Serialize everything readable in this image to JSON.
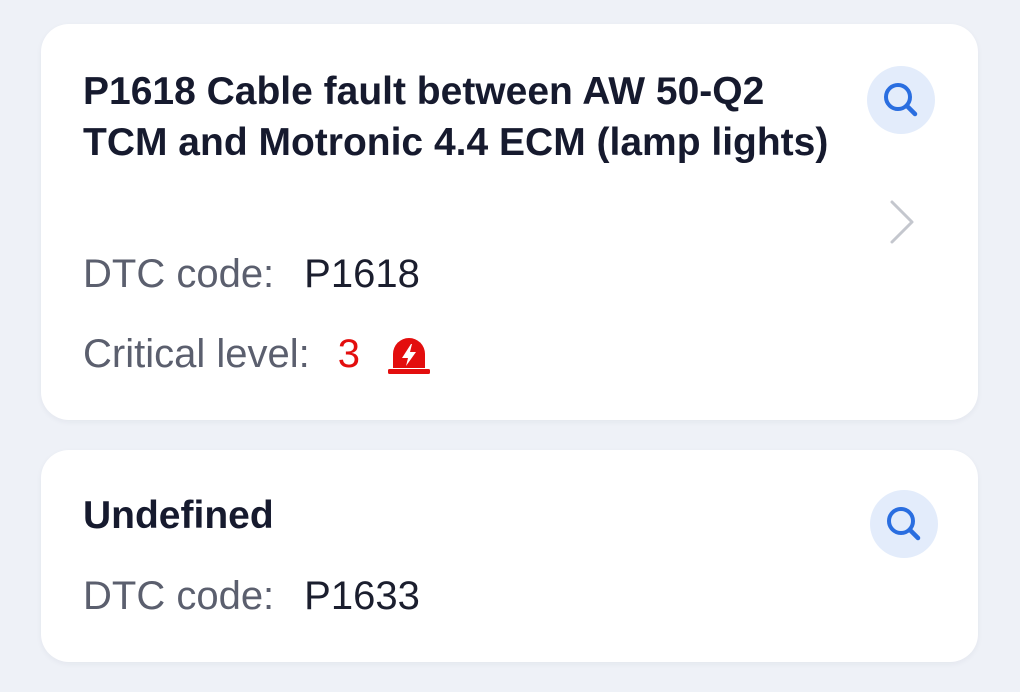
{
  "labels": {
    "dtc_code": "DTC code:",
    "critical_level": "Critical level:"
  },
  "faults": [
    {
      "title": "P1618 Cable fault between AW 50-Q2 TCM and Motronic 4.4 ECM (lamp lights)",
      "dtc_code": "P1618",
      "critical_level": "3",
      "icons": [
        "search-icon",
        "chevron-right-icon",
        "siren-alarm-icon"
      ]
    },
    {
      "title": "Undefined",
      "dtc_code": "P1633",
      "icons": [
        "search-icon"
      ]
    }
  ],
  "colors": {
    "background": "#eef1f7",
    "card": "#ffffff",
    "title": "#161a2e",
    "label": "#5b5f6e",
    "critical": "#e30e0e",
    "search_accent": "#2a6ee0",
    "search_bg": "#e3ecfb"
  }
}
